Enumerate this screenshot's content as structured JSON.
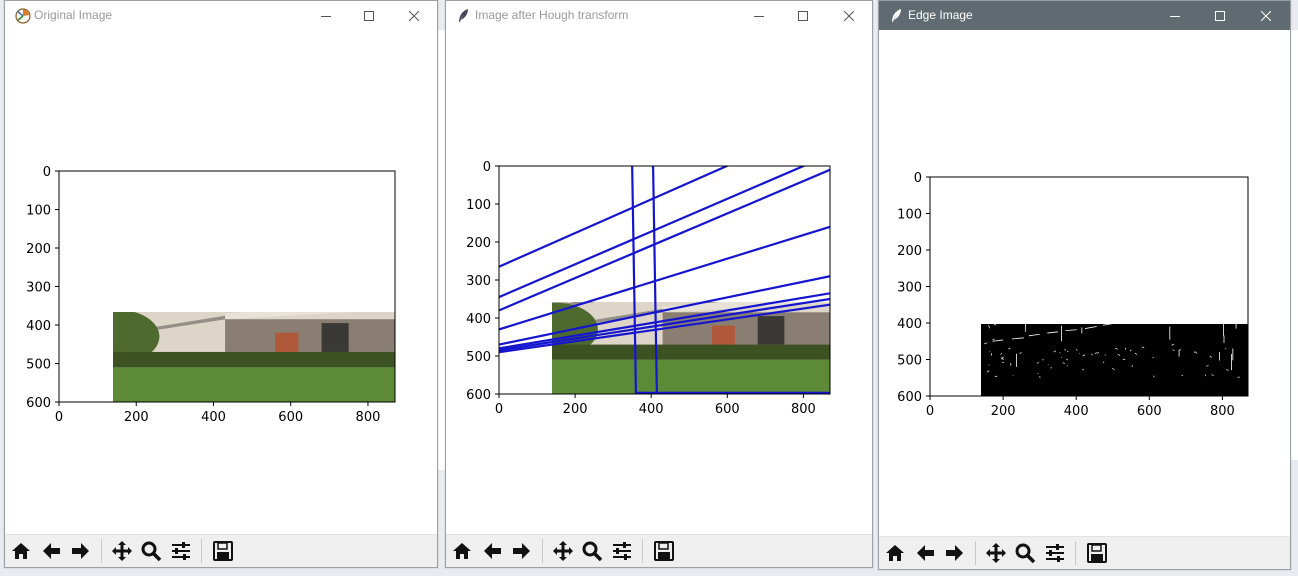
{
  "windows": [
    {
      "id": "original",
      "title": "Original Image",
      "icon": "matplotlib-icon",
      "active": false,
      "plot": {
        "xlim": [
          0,
          870
        ],
        "ylim": [
          600,
          0
        ],
        "x_ticks": [
          "0",
          "200",
          "400",
          "600",
          "800"
        ],
        "y_ticks": [
          "0",
          "100",
          "200",
          "300",
          "400",
          "500",
          "600"
        ],
        "image": "photo-building"
      }
    },
    {
      "id": "hough",
      "title": "Image after Hough transform",
      "icon": "feather-icon",
      "active": false,
      "plot": {
        "xlim": [
          0,
          870
        ],
        "ylim": [
          600,
          0
        ],
        "x_ticks": [
          "0",
          "200",
          "400",
          "600",
          "800"
        ],
        "y_ticks": [
          "0",
          "100",
          "200",
          "300",
          "400",
          "500",
          "600"
        ],
        "image": "photo-building-with-lines",
        "line_color": "#1515d0"
      }
    },
    {
      "id": "edge",
      "title": "Edge Image",
      "icon": "feather-icon",
      "active": true,
      "plot": {
        "xlim": [
          0,
          870
        ],
        "ylim": [
          600,
          0
        ],
        "x_ticks": [
          "0",
          "200",
          "400",
          "600",
          "800"
        ],
        "y_ticks": [
          "0",
          "100",
          "200",
          "300",
          "400",
          "500",
          "600"
        ],
        "image": "edge-map"
      }
    }
  ],
  "toolbar": {
    "buttons": [
      "home-icon",
      "back-arrow-icon",
      "forward-arrow-icon",
      "pan-icon",
      "zoom-icon",
      "configure-subplots-icon",
      "save-icon"
    ]
  },
  "colors": {
    "titlebar_active": "#5f6b70",
    "hough_lines": "#1515d0"
  }
}
